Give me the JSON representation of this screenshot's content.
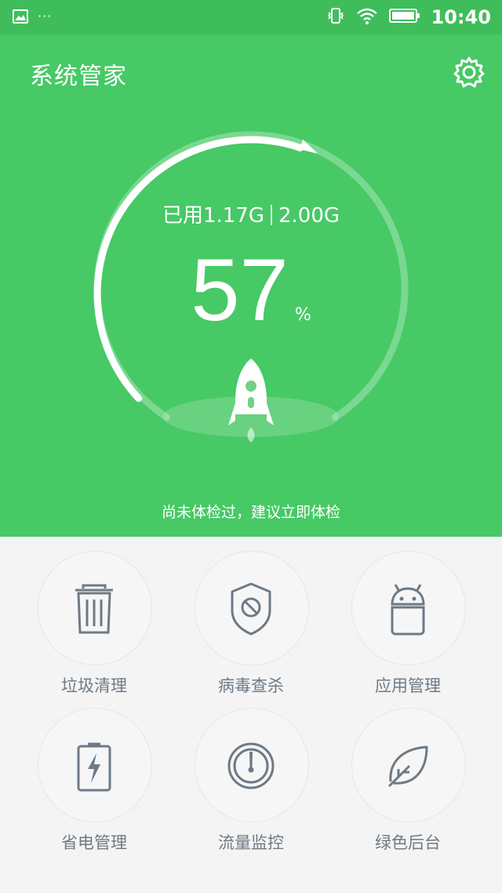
{
  "status_bar": {
    "time": "10:40",
    "dots": "···"
  },
  "header": {
    "title": "系统管家"
  },
  "memory": {
    "used_label": "已用1.17G",
    "total_label": "2.00G",
    "percent": "57",
    "percent_unit": "%",
    "usage_fraction": 0.57
  },
  "hint": "尚未体检过，建议立即体检",
  "tools": [
    {
      "label": "垃圾清理",
      "icon": "trash-icon"
    },
    {
      "label": "病毒查杀",
      "icon": "shield-icon"
    },
    {
      "label": "应用管理",
      "icon": "android-icon"
    },
    {
      "label": "省电管理",
      "icon": "battery-icon"
    },
    {
      "label": "流量监控",
      "icon": "gauge-icon"
    },
    {
      "label": "绿色后台",
      "icon": "leaf-icon"
    }
  ],
  "colors": {
    "header": "#47c966",
    "status": "#3fbd5b",
    "icon": "#6e7a86"
  }
}
